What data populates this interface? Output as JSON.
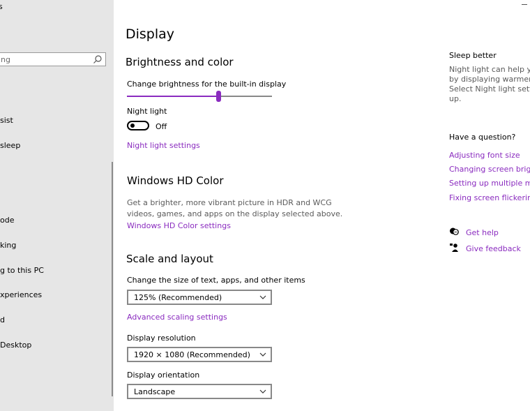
{
  "sidebar": {
    "title": "s",
    "search_placeholder": "ng",
    "items": [
      {
        "label": "sist"
      },
      {
        "label": " sleep"
      },
      {
        "label": "ode"
      },
      {
        "label": "king"
      },
      {
        "label": "g to this PC"
      },
      {
        "label": "xperiences"
      },
      {
        "label": "d"
      },
      {
        "label": "Desktop"
      }
    ]
  },
  "main": {
    "title": "Display",
    "brightness": {
      "heading": "Brightness and color",
      "slider_label": "Change brightness for the built-in display",
      "slider_value": 0.63,
      "night_light_label": "Night light",
      "night_light_state": "Off",
      "night_light_link": "Night light settings"
    },
    "hd_color": {
      "heading": "Windows HD Color",
      "description": "Get a brighter, more vibrant picture in HDR and WCG videos, games, and apps on the display selected above.",
      "link": "Windows HD Color settings"
    },
    "scale": {
      "heading": "Scale and layout",
      "size_label": "Change the size of text, apps, and other items",
      "size_value": "125% (Recommended)",
      "advanced_link": "Advanced scaling settings",
      "resolution_label": "Display resolution",
      "resolution_value": "1920 × 1080 (Recommended)",
      "orientation_label": "Display orientation",
      "orientation_value": "Landscape"
    }
  },
  "right_panel": {
    "sleep_heading": "Sleep better",
    "sleep_desc": "Night light can help you g\nby displaying warmer colo\nSelect Night light settings\nup.",
    "question_heading": "Have a question?",
    "links": [
      "Adjusting font size",
      "Changing screen brightne",
      "Setting up multiple monit",
      "Fixing screen flickering"
    ],
    "get_help": "Get help",
    "give_feedback": "Give feedback"
  },
  "colors": {
    "accent": "#8a2bbf",
    "sidebar_bg": "#e6e6e6"
  }
}
